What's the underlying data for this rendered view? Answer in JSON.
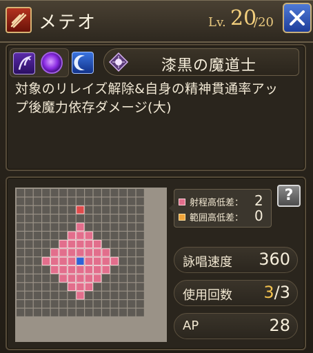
{
  "header": {
    "skill_name": "メテオ",
    "level_prefix": "Lv.",
    "level_current": "20",
    "level_max_text": "/20",
    "skill_type_icon": "attack-slash-icon",
    "close_icon": "close-x-icon"
  },
  "tags": {
    "status_icons": [
      "curse-reaper-icon",
      "dark-orb-icon"
    ],
    "element_icon": "moon-crescent-icon",
    "job_emblem": "dark-sorcerer-emblem-icon",
    "job_name": "漆黒の魔道士"
  },
  "description": {
    "line1": "対象のリレイズ解除&自身の精神貫通率アッ",
    "line2": "プ後魔力依存ダメージ(大)"
  },
  "range": {
    "tooltip": {
      "range_height_label": "射程高低差：",
      "range_height_value": "2",
      "area_height_label": "範囲高低差：",
      "area_height_value": "0"
    },
    "help_label": "?",
    "colors": {
      "grid_bg": "#9a9287",
      "cell_empty": "#5e5a54",
      "cell_area": "#e26e8c",
      "cell_target": "#e04b4b",
      "cell_caster": "#2e63d6"
    }
  },
  "stats": {
    "cast_speed_label": "詠唱速度",
    "cast_speed_value": "360",
    "uses_label": "使用回数",
    "uses_current": "3",
    "uses_max_text": "/3",
    "ap_label": "AP",
    "ap_value": "28"
  }
}
